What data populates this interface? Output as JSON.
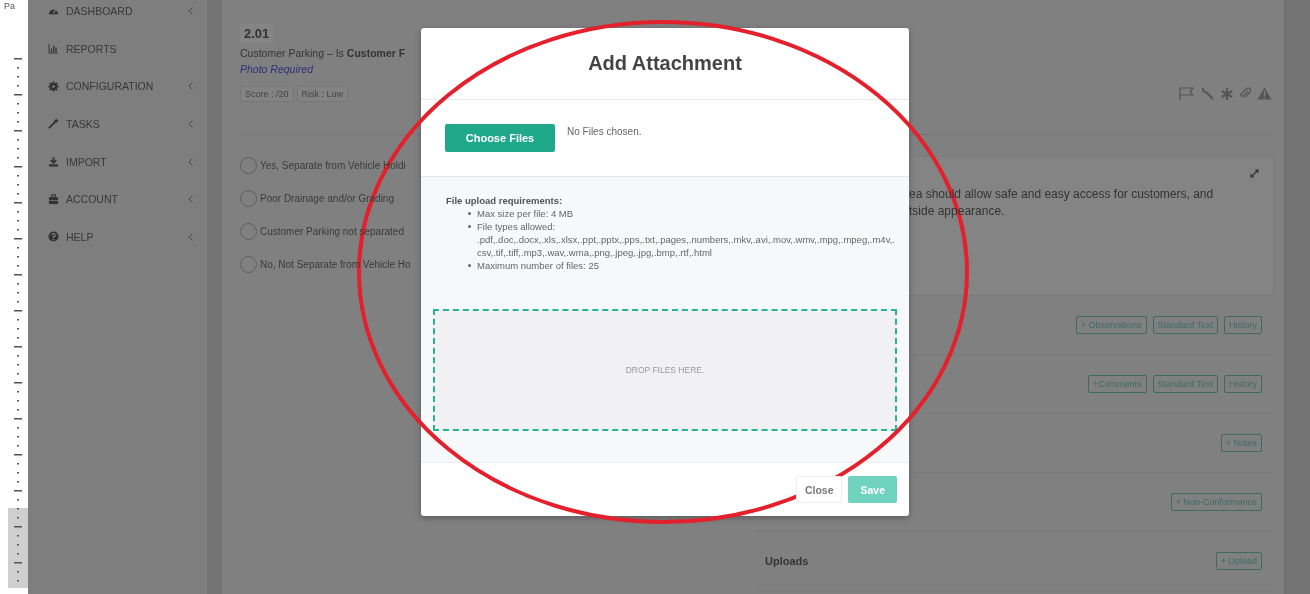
{
  "editor_frame": {
    "label": "Pa"
  },
  "sidebar": {
    "items": [
      {
        "label": "DASHBOARD",
        "has_submenu": true
      },
      {
        "label": "REPORTS",
        "has_submenu": false
      },
      {
        "label": "CONFIGURATION",
        "has_submenu": true
      },
      {
        "label": "TASKS",
        "has_submenu": true
      },
      {
        "label": "IMPORT",
        "has_submenu": true
      },
      {
        "label": "ACCOUNT",
        "has_submenu": true
      },
      {
        "label": "HELP",
        "has_submenu": true
      }
    ]
  },
  "question": {
    "number": "2.01",
    "text": "Customer Parking – Is **Customer F**",
    "note": "Photo Required",
    "tags": [
      "Score : /20",
      "Risk : Low"
    ],
    "options": [
      {
        "label": "Yes, Separate from Vehicle Holdi",
        "selected": false
      },
      {
        "label": "Poor Drainage and/or Grading",
        "selected": false
      },
      {
        "label": "Customer Parking not separated",
        "selected": false
      },
      {
        "label": "No, Not Separate from Vehicle Ho",
        "selected": false
      }
    ]
  },
  "description": {
    "lines": [
      "ea should allow safe and easy access for customers, and",
      "tside appearance."
    ]
  },
  "sections": [
    {
      "buttons": [
        "+ Observations",
        "Standard Text",
        "History"
      ]
    },
    {
      "buttons": [
        "+Comments",
        "Standard Text",
        "History"
      ]
    },
    {
      "buttons": [
        "+ Notes"
      ]
    },
    {
      "buttons": [
        "+ Non-Conformance"
      ]
    },
    {
      "title": "Uploads",
      "buttons": [
        "+ Upload"
      ]
    }
  ],
  "modal": {
    "title": "Add Attachment",
    "choose_button": "Choose Files",
    "file_status": "No Files chosen.",
    "requirements": {
      "heading": "File upload requirements:",
      "items": [
        {
          "text": "Max size per file: 4 MB"
        },
        {
          "text": "File types allowed:",
          "detail": ".pdf,.doc,.docx,.xls,.xlsx,.ppt,.pptx,.pps,.txt,.pages,.numbers,.mkv,.avi,.mov,.wmv,.mpg,.mpeg,.m4v,.csv,.tif,.tiff,.mp3,.wav,.wma,.png,.jpeg,.jpg,.bmp,.rtf,.html"
        },
        {
          "text": "Maximum number of files: 25"
        }
      ]
    },
    "dropzone": "DROP FILES HERE.",
    "buttons": [
      {
        "label": "Close",
        "kind": "default",
        "disabled": false
      },
      {
        "label": "Save",
        "kind": "primary",
        "disabled": true
      }
    ]
  }
}
